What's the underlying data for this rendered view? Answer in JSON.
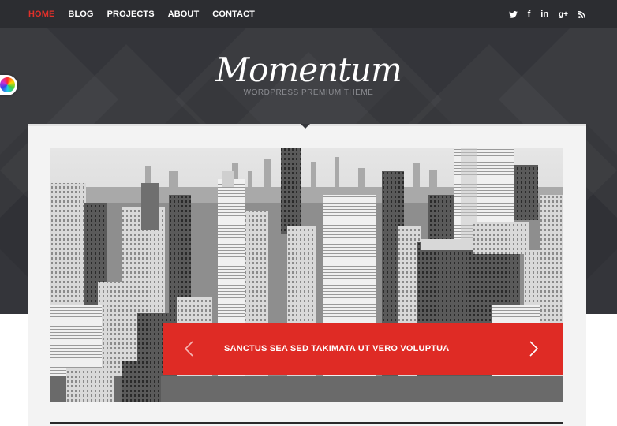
{
  "nav": {
    "items": [
      {
        "label": "HOME",
        "active": true
      },
      {
        "label": "BLOG"
      },
      {
        "label": "PROJECTS"
      },
      {
        "label": "ABOUT"
      },
      {
        "label": "CONTACT"
      }
    ],
    "active_color": "#e0302a"
  },
  "social": {
    "icons": [
      "twitter-icon",
      "facebook-icon",
      "linkedin-icon",
      "google-plus-icon",
      "rss-icon"
    ],
    "labels": {
      "facebook": "f",
      "linkedin": "in",
      "google_plus": "g+"
    }
  },
  "header": {
    "logo": "Momentum",
    "tagline": "WORDPRESS PREMIUM THEME"
  },
  "slider": {
    "caption": "SANCTUS SEA SED TAKIMATA UT VERO VOLUPTUA",
    "image": "black-and-white city skyline",
    "caption_color": "#df2b25"
  },
  "colors": {
    "topbar": "#2c2d31",
    "header": "#34353a",
    "container": "#f3f3f3"
  },
  "widgets": {
    "color_switcher": "color-wheel-icon"
  }
}
